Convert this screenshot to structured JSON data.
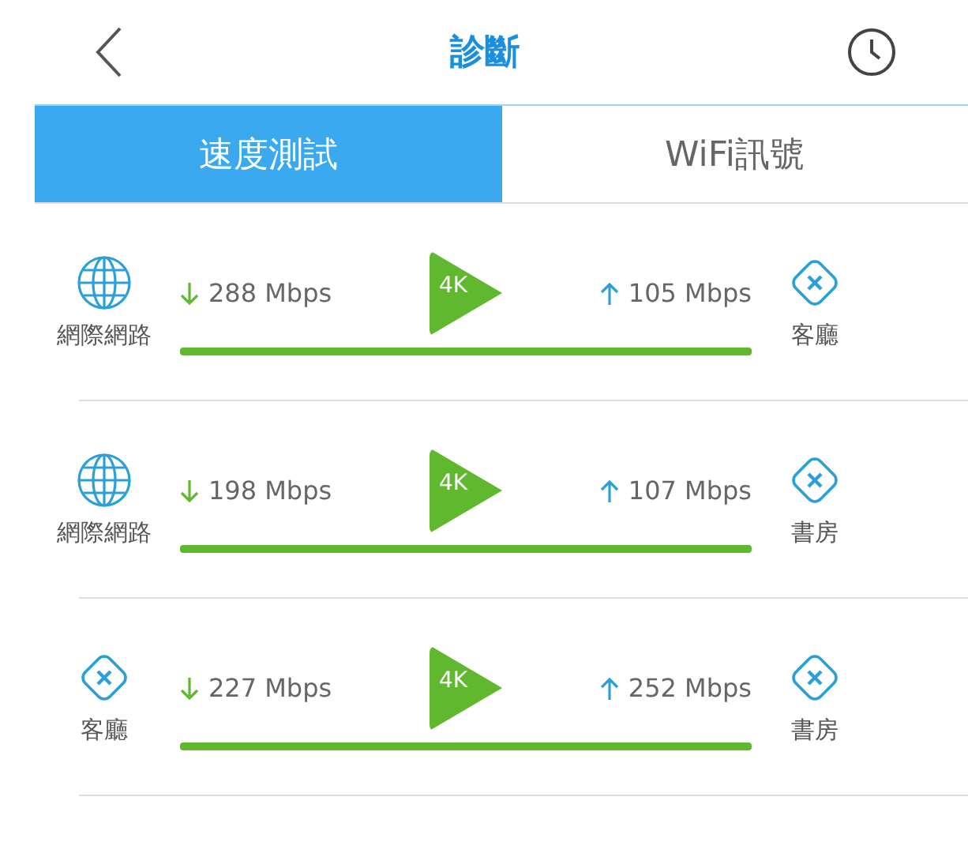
{
  "header": {
    "title": "診斷"
  },
  "tabs": [
    {
      "label": "速度測試",
      "selected": true
    },
    {
      "label": "WiFi訊號",
      "selected": false
    }
  ],
  "tests": [
    {
      "from": {
        "kind": "internet",
        "label": "網際網路"
      },
      "download": "288 Mbps",
      "badge": "4K",
      "upload": "105 Mbps",
      "to": {
        "kind": "node",
        "label": "客廳"
      }
    },
    {
      "from": {
        "kind": "internet",
        "label": "網際網路"
      },
      "download": "198 Mbps",
      "badge": "4K",
      "upload": "107 Mbps",
      "to": {
        "kind": "node",
        "label": "書房"
      }
    },
    {
      "from": {
        "kind": "node",
        "label": "客廳"
      },
      "download": "227 Mbps",
      "badge": "4K",
      "upload": "252 Mbps",
      "to": {
        "kind": "node",
        "label": "書房"
      }
    }
  ]
}
